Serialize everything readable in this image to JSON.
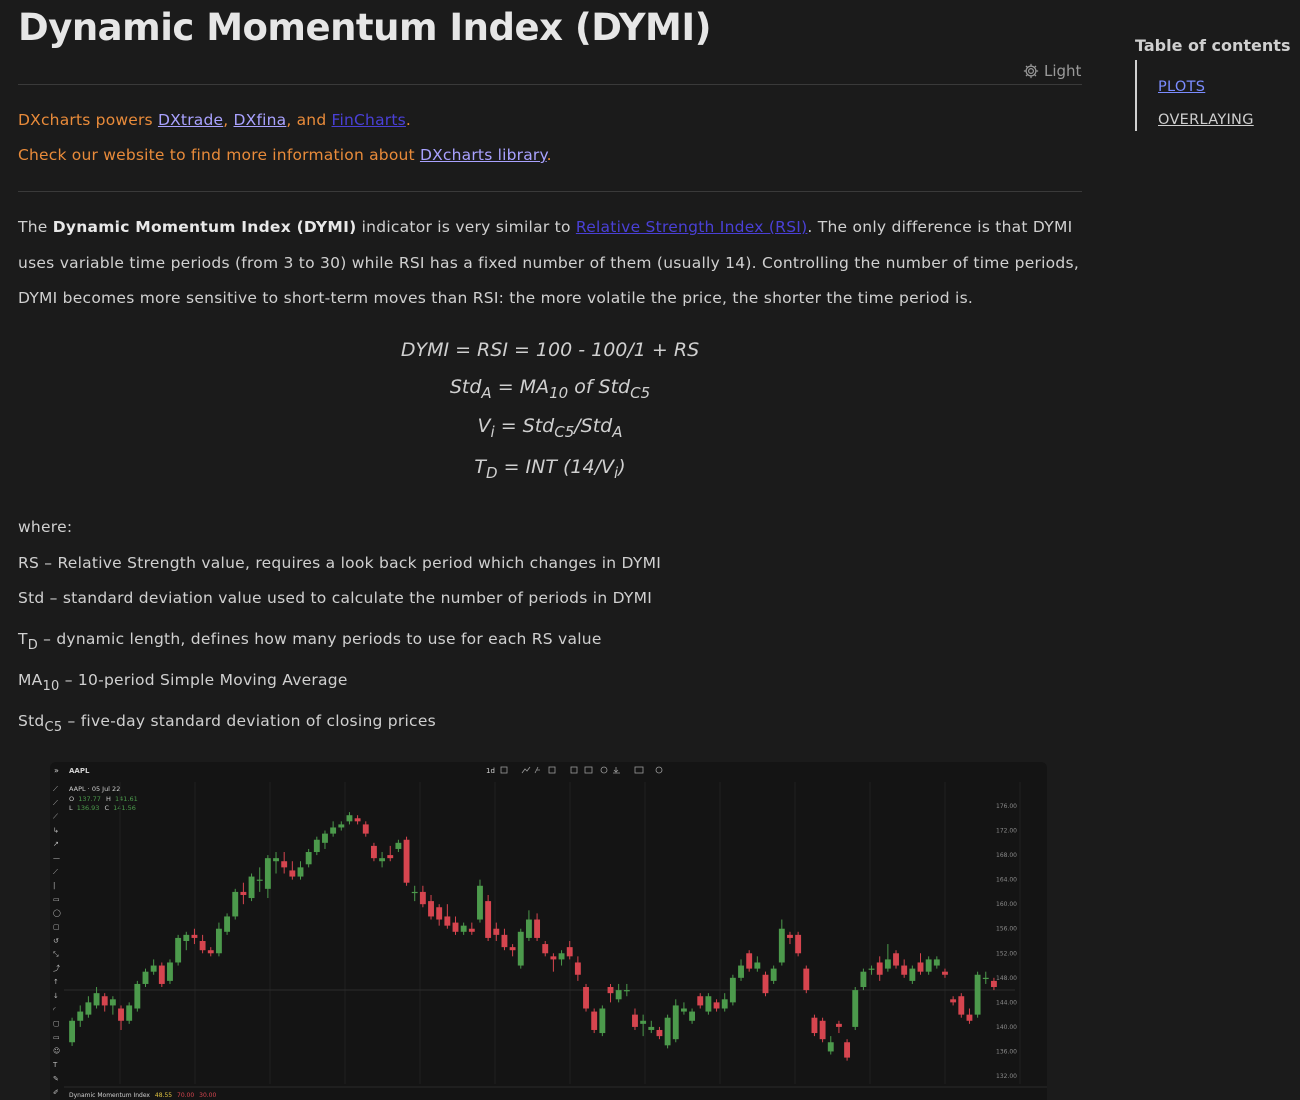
{
  "page": {
    "title": "Dynamic Momentum Index (DYMI)",
    "theme_label": "Light"
  },
  "promo": {
    "line1_prefix": "DXcharts powers ",
    "link_dxtrade": "DXtrade",
    "sep1": ", ",
    "link_dxfina": "DXfina",
    "sep2": ", and ",
    "link_fincharts": "FinCharts",
    "line1_suffix": ".",
    "line2_prefix": "Check our website to find more information about ",
    "link_library": "DXcharts library",
    "line2_suffix": "."
  },
  "intro": {
    "p1": "The ",
    "bold": "Dynamic Momentum Index (DYMI)",
    "p2": " indicator is very similar to ",
    "link_rsi": "Relative Strength Index (RSI)",
    "p3": ". The only difference is that DYMI uses variable time periods (from 3 to 30) while RSI has a fixed number of them (usually 14). Controlling the number of time periods, DYMI becomes more sensitive to short-term moves than RSI: the more volatile the price, the shorter the time period is."
  },
  "formulas": {
    "f1": "DYMI = RSI = 100 - 100/1 + RS",
    "f2_a": "Std",
    "f2_a_sub": "A",
    "f2_b": " = MA",
    "f2_b_sub": "10",
    "f2_c": " of Std",
    "f2_c_sub": "C5",
    "f3_a": "V",
    "f3_a_sub": "i",
    "f3_b": " = Std",
    "f3_b_sub": "C5",
    "f3_c": "/Std",
    "f3_c_sub": "A",
    "f4_a": "T",
    "f4_a_sub": "D",
    "f4_b": " = INT (14/V",
    "f4_b_sub": "i",
    "f4_c": ")"
  },
  "definitions": {
    "where": "where:",
    "rs": "RS – Relative Strength value, requires a look back period which changes in DYMI",
    "std": "Std – standard deviation value used to calculate the number of periods in DYMI",
    "td_main": "T",
    "td_sub": "D",
    "td_text": " – dynamic length, defines how many periods to use for each RS value",
    "ma_main": "MA",
    "ma_sub": "10",
    "ma_text": " – 10-period Simple Moving Average",
    "std5_main": "Std",
    "std5_sub": "C5",
    "std5_text": " – five-day standard deviation of closing prices"
  },
  "toc": {
    "title": "Table of contents",
    "items": [
      "PLOTS",
      "OVERLAYING"
    ]
  },
  "chart": {
    "symbol": "AAPL",
    "interval": "1d",
    "legend_title": "AAPL · 05 Jul 22",
    "ohlc": {
      "o_label": "O",
      "o": "137.77",
      "h_label": "H",
      "h": "141.61",
      "l_label": "L",
      "l": "136.93",
      "c_label": "C",
      "c": "141.56"
    },
    "indicator_label": "Dynamic Momentum Index",
    "indicator_value": "48.55",
    "indicator_levels": [
      "70.00",
      "30.00"
    ],
    "colors": {
      "up": "#4c9a4c",
      "down": "#d6454f",
      "bg": "#141414"
    }
  },
  "chart_data": {
    "type": "candlestick",
    "y_ticks": [
      "176.00",
      "172.00",
      "168.00",
      "164.00",
      "160.00",
      "156.00",
      "152.00",
      "148.00",
      "144.00",
      "140.00",
      "136.00",
      "132.00"
    ],
    "ylim": [
      132,
      176
    ],
    "candles": [
      [
        137.5,
        141.0,
        136.9,
        141.5
      ],
      [
        141.0,
        142.5,
        140.0,
        143.5
      ],
      [
        142.0,
        144.0,
        141.5,
        145.0
      ],
      [
        143.5,
        145.5,
        143.0,
        146.5
      ],
      [
        145.0,
        143.5,
        142.5,
        145.5
      ],
      [
        143.5,
        144.5,
        142.0,
        145.0
      ],
      [
        143.0,
        141.0,
        139.5,
        143.5
      ],
      [
        141.0,
        143.5,
        140.5,
        144.0
      ],
      [
        143.0,
        147.0,
        142.5,
        147.5
      ],
      [
        147.0,
        149.0,
        146.5,
        149.5
      ],
      [
        149.0,
        150.0,
        148.5,
        151.0
      ],
      [
        150.0,
        147.0,
        146.5,
        150.5
      ],
      [
        147.5,
        150.5,
        147.0,
        151.0
      ],
      [
        150.5,
        154.5,
        150.0,
        155.0
      ],
      [
        154.0,
        155.0,
        152.5,
        155.5
      ],
      [
        155.0,
        154.5,
        153.5,
        156.0
      ],
      [
        154.0,
        152.5,
        152.0,
        155.0
      ],
      [
        152.5,
        152.0,
        151.5,
        153.0
      ],
      [
        152.0,
        156.0,
        151.5,
        157.0
      ],
      [
        155.5,
        158.0,
        155.0,
        158.5
      ],
      [
        158.0,
        162.0,
        157.5,
        162.5
      ],
      [
        162.0,
        161.5,
        160.0,
        163.5
      ],
      [
        161.0,
        164.5,
        160.5,
        165.0
      ],
      [
        164.0,
        164.0,
        162.0,
        166.0
      ],
      [
        162.5,
        167.5,
        161.0,
        168.0
      ],
      [
        167.0,
        167.5,
        165.0,
        168.5
      ],
      [
        167.0,
        166.0,
        165.0,
        168.5
      ],
      [
        165.5,
        164.5,
        164.0,
        167.0
      ],
      [
        164.5,
        166.0,
        164.0,
        167.0
      ],
      [
        166.5,
        168.5,
        166.0,
        169.0
      ],
      [
        168.5,
        170.5,
        168.0,
        171.0
      ],
      [
        170.0,
        171.5,
        169.0,
        172.0
      ],
      [
        171.5,
        172.5,
        171.0,
        173.5
      ],
      [
        172.5,
        173.0,
        172.0,
        173.5
      ],
      [
        173.5,
        174.5,
        173.0,
        175.0
      ],
      [
        174.0,
        173.5,
        173.0,
        174.5
      ],
      [
        173.0,
        171.5,
        171.0,
        173.5
      ],
      [
        169.5,
        167.5,
        167.0,
        170.0
      ],
      [
        167.0,
        167.5,
        166.0,
        168.5
      ],
      [
        168.0,
        167.5,
        167.0,
        169.5
      ],
      [
        169.0,
        170.0,
        168.5,
        170.5
      ],
      [
        170.5,
        163.5,
        163.0,
        171.0
      ],
      [
        162.0,
        162.0,
        160.5,
        163.0
      ],
      [
        162.0,
        160.0,
        159.5,
        163.0
      ],
      [
        160.5,
        158.0,
        157.5,
        161.5
      ],
      [
        159.5,
        157.5,
        156.5,
        160.0
      ],
      [
        158.0,
        156.5,
        156.0,
        160.0
      ],
      [
        157.0,
        155.5,
        155.0,
        158.0
      ],
      [
        155.5,
        156.5,
        155.0,
        157.0
      ],
      [
        156.0,
        155.5,
        155.0,
        157.0
      ],
      [
        157.5,
        163.0,
        157.0,
        164.0
      ],
      [
        160.5,
        154.5,
        154.0,
        161.5
      ],
      [
        156.0,
        155.0,
        154.0,
        157.0
      ],
      [
        155.0,
        153.0,
        152.5,
        156.0
      ],
      [
        153.0,
        152.5,
        151.5,
        153.5
      ],
      [
        150.0,
        155.5,
        149.5,
        156.0
      ],
      [
        154.5,
        157.5,
        154.0,
        159.0
      ],
      [
        157.5,
        154.5,
        154.0,
        158.5
      ],
      [
        153.5,
        152.0,
        151.5,
        154.0
      ],
      [
        151.5,
        151.0,
        149.0,
        152.0
      ],
      [
        151.0,
        152.0,
        150.0,
        152.5
      ],
      [
        153.0,
        151.5,
        151.0,
        154.0
      ],
      [
        150.5,
        148.5,
        147.5,
        151.5
      ],
      [
        146.5,
        143.0,
        142.5,
        147.0
      ],
      [
        142.5,
        139.5,
        139.0,
        143.0
      ],
      [
        139.0,
        143.0,
        138.5,
        143.5
      ],
      [
        146.5,
        145.5,
        144.0,
        147.0
      ],
      [
        144.5,
        146.0,
        144.0,
        147.0
      ],
      [
        146.0,
        146.0,
        145.0,
        147.0
      ],
      [
        142.0,
        140.0,
        139.5,
        143.0
      ],
      [
        140.5,
        141.0,
        138.5,
        142.0
      ],
      [
        139.5,
        140.0,
        139.0,
        141.0
      ],
      [
        139.5,
        138.5,
        138.0,
        140.0
      ],
      [
        137.0,
        141.5,
        136.5,
        142.0
      ],
      [
        138.0,
        143.5,
        137.5,
        144.5
      ],
      [
        142.5,
        143.0,
        142.0,
        144.0
      ],
      [
        141.0,
        142.5,
        140.5,
        143.0
      ],
      [
        145.0,
        143.5,
        143.0,
        145.5
      ],
      [
        142.5,
        145.0,
        142.0,
        145.5
      ],
      [
        144.0,
        143.0,
        142.5,
        144.5
      ],
      [
        143.0,
        144.5,
        142.5,
        145.5
      ],
      [
        144.0,
        148.0,
        143.5,
        148.5
      ],
      [
        148.0,
        150.0,
        147.5,
        151.0
      ],
      [
        152.0,
        149.5,
        149.0,
        152.5
      ],
      [
        149.5,
        150.5,
        149.0,
        151.5
      ],
      [
        148.5,
        145.5,
        145.0,
        149.0
      ],
      [
        147.5,
        149.5,
        147.0,
        150.0
      ],
      [
        150.5,
        156.0,
        150.0,
        157.5
      ],
      [
        155.0,
        154.5,
        153.5,
        155.5
      ],
      [
        155.0,
        152.0,
        151.5,
        155.5
      ],
      [
        149.5,
        146.0,
        145.5,
        150.0
      ],
      [
        141.5,
        139.0,
        138.5,
        142.0
      ],
      [
        141.0,
        138.0,
        137.5,
        141.5
      ],
      [
        136.0,
        137.5,
        135.5,
        138.5
      ],
      [
        140.5,
        140.0,
        139.0,
        141.0
      ],
      [
        137.5,
        135.0,
        134.5,
        138.0
      ],
      [
        140.0,
        146.0,
        139.5,
        146.5
      ],
      [
        146.5,
        149.0,
        146.0,
        149.5
      ],
      [
        149.5,
        149.5,
        148.5,
        150.0
      ],
      [
        150.5,
        148.5,
        147.5,
        151.5
      ],
      [
        149.5,
        151.0,
        149.0,
        153.5
      ],
      [
        152.0,
        150.0,
        149.5,
        152.5
      ],
      [
        150.0,
        148.5,
        148.0,
        151.0
      ],
      [
        147.5,
        149.5,
        147.0,
        150.0
      ],
      [
        150.5,
        149.0,
        148.5,
        152.0
      ],
      [
        149.0,
        151.0,
        148.5,
        151.5
      ],
      [
        150.0,
        151.0,
        149.5,
        151.5
      ],
      [
        149.0,
        148.5,
        148.0,
        149.5
      ],
      [
        144.5,
        144.0,
        143.5,
        145.0
      ],
      [
        145.0,
        142.0,
        141.5,
        145.5
      ],
      [
        142.0,
        141.0,
        140.5,
        143.0
      ],
      [
        142.0,
        148.5,
        141.5,
        149.0
      ],
      [
        148.0,
        148.0,
        147.0,
        149.0
      ],
      [
        147.5,
        146.5,
        146.0,
        148.0
      ]
    ]
  }
}
